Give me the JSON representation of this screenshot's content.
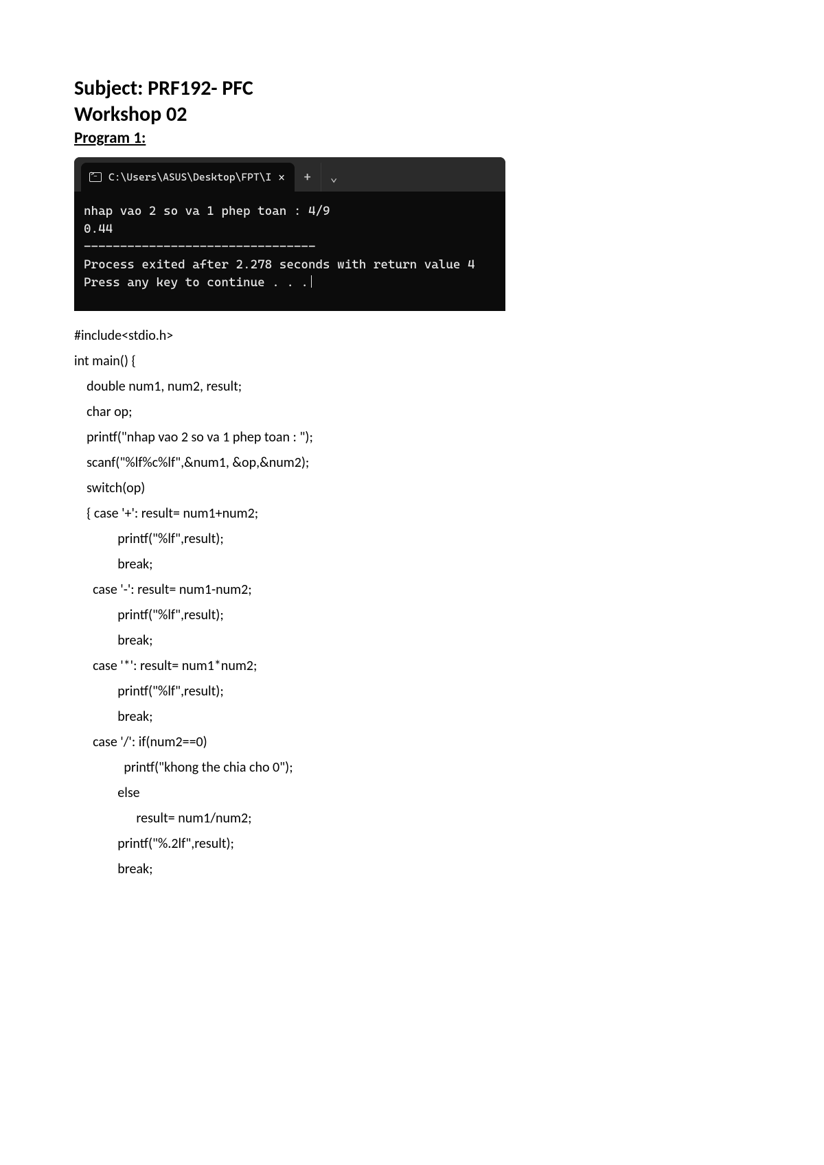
{
  "heading": {
    "subject": "Subject: PRF192- PFC",
    "workshop": "Workshop 02",
    "program": "Program 1:"
  },
  "terminal": {
    "tab_title": "C:\\Users\\ASUS\\Desktop\\FPT\\I",
    "lines": {
      "l1": "nhap vao 2 so va 1 phep toan : 4/9",
      "l2": "0.44",
      "l3": "--------------------------------",
      "l4": "Process exited after 2.278 seconds with return value 4",
      "l5": "Press any key to continue . . ."
    }
  },
  "code": {
    "c00": "#include<stdio.h>",
    "c01": "int main() {",
    "c02": "    double num1, num2, result;",
    "c03": "    char op;",
    "c04": "    printf(\"nhap vao 2 so va 1 phep toan : \");",
    "c05": "    scanf(\"%lf%c%lf\",&num1, &op,&num2);",
    "c06": "    switch(op)",
    "c07": "    { case '+': result= num1+num2;",
    "c08": "              printf(\"%lf\",result);",
    "c09": "              break;",
    "c10": "      case '-': result= num1-num2;",
    "c11": "              printf(\"%lf\",result);",
    "c12": "              break;",
    "c13": "      case '*': result= num1*num2;",
    "c14": "              printf(\"%lf\",result);",
    "c15": "              break;",
    "c16": "      case '/': if(num2==0)",
    "c17": "                printf(\"khong the chia cho 0\");",
    "c18": "              else",
    "c19": "                    result= num1/num2;",
    "c20": "              printf(\"%.2lf\",result);",
    "c21": "              break;"
  }
}
